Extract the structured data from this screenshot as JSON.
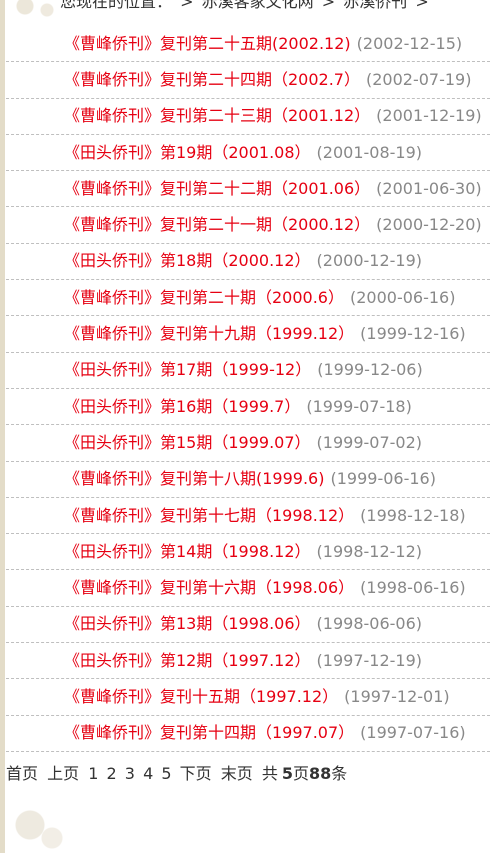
{
  "breadcrumb": {
    "prefix": "您现在的位置：",
    "sep": ">",
    "items": [
      "赤溪客家文化网",
      "赤溪侨刊"
    ]
  },
  "articles": [
    {
      "title": "《曹峰侨刊》复刊第二十五期(2002.12)",
      "date": "(2002-12-15)"
    },
    {
      "title": "《曹峰侨刊》复刊第二十四期（2002.7）",
      "date": "(2002-07-19)"
    },
    {
      "title": "《曹峰侨刊》复刊第二十三期（2001.12）",
      "date": "(2001-12-19)"
    },
    {
      "title": "《田头侨刊》第19期（2001.08）",
      "date": "(2001-08-19)"
    },
    {
      "title": "《曹峰侨刊》复刊第二十二期（2001.06）",
      "date": "(2001-06-30)"
    },
    {
      "title": "《曹峰侨刊》复刊第二十一期（2000.12）",
      "date": "(2000-12-20)"
    },
    {
      "title": "《田头侨刊》第18期（2000.12）",
      "date": "(2000-12-19)"
    },
    {
      "title": "《曹峰侨刊》复刊第二十期（2000.6）",
      "date": "(2000-06-16)"
    },
    {
      "title": "《曹峰侨刊》复刊第十九期（1999.12）",
      "date": "(1999-12-16)"
    },
    {
      "title": "《田头侨刊》第17期（1999-12）",
      "date": "(1999-12-06)"
    },
    {
      "title": "《田头侨刊》第16期（1999.7）",
      "date": "(1999-07-18)"
    },
    {
      "title": "《田头侨刊》第15期（1999.07）",
      "date": "(1999-07-02)"
    },
    {
      "title": "《曹峰侨刊》复刊第十八期(1999.6)",
      "date": "(1999-06-16)"
    },
    {
      "title": "《曹峰侨刊》复刊第十七期（1998.12）",
      "date": "(1998-12-18)"
    },
    {
      "title": "《田头侨刊》第14期（1998.12）",
      "date": "(1998-12-12)"
    },
    {
      "title": "《曹峰侨刊》复刊第十六期（1998.06）",
      "date": "(1998-06-16)"
    },
    {
      "title": "《田头侨刊》第13期（1998.06）",
      "date": "(1998-06-06)"
    },
    {
      "title": "《田头侨刊》第12期（1997.12）",
      "date": "(1997-12-19)"
    },
    {
      "title": "《曹峰侨刊》复刊十五期（1997.12）",
      "date": "(1997-12-01)"
    },
    {
      "title": "《曹峰侨刊》复刊第十四期（1997.07）",
      "date": "(1997-07-16)"
    }
  ],
  "pager": {
    "first": "首页",
    "prev": "上页",
    "pages": [
      "1",
      "2",
      "3",
      "4",
      "5"
    ],
    "next": "下页",
    "last": "末页",
    "total_prefix": "共",
    "total_pages": "5",
    "pages_unit": "页",
    "total_items": "88",
    "items_unit": "条"
  }
}
